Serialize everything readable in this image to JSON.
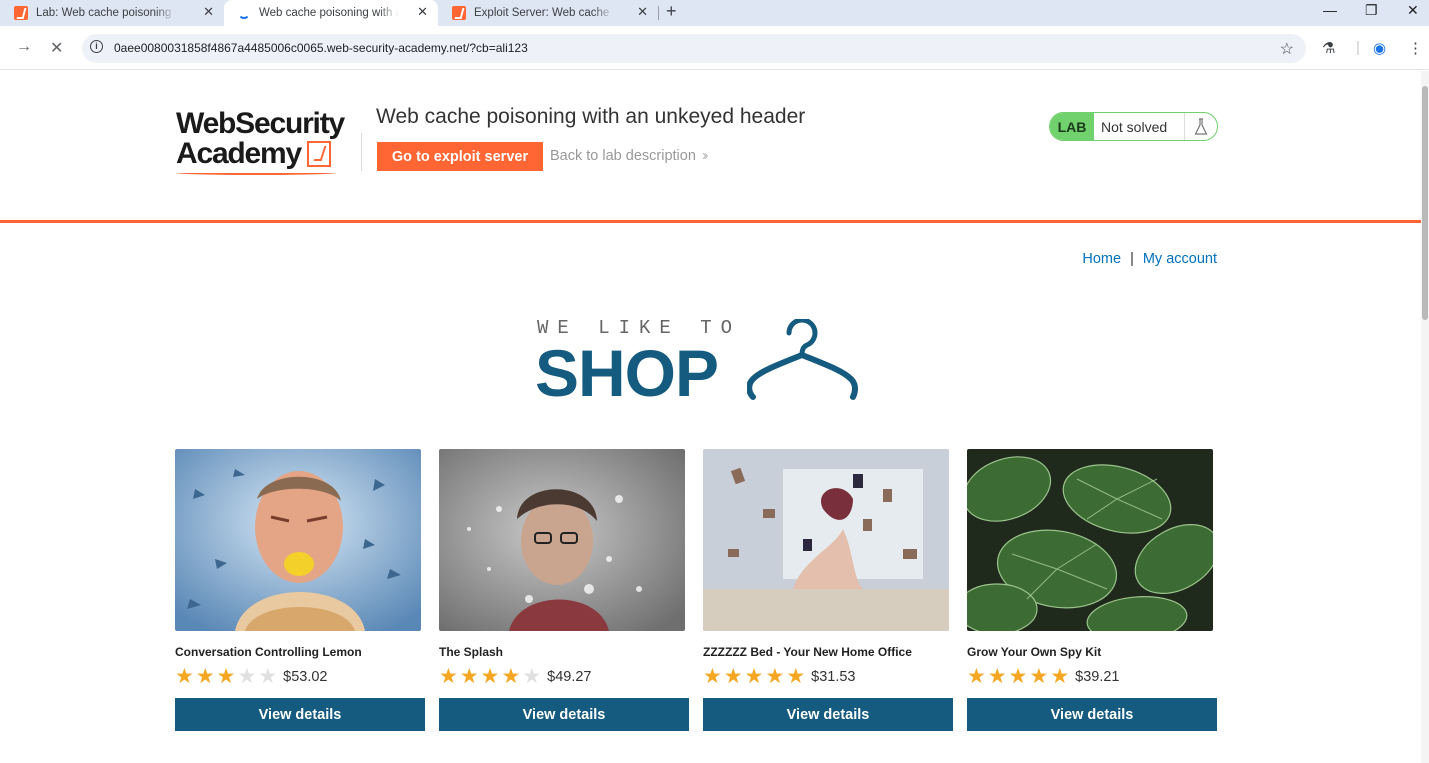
{
  "browser": {
    "tabs": [
      {
        "title": "Lab: Web cache poisoning with an unkeyed header",
        "active": false
      },
      {
        "title": "Web cache poisoning with an unkeyed header",
        "active": true
      },
      {
        "title": "Exploit Server: Web cache poisoning with an unkeyed header",
        "active": false
      }
    ],
    "url": "0aee0080031858f4867a4485006c0065.web-security-academy.net/?cb=ali123"
  },
  "header": {
    "logo_line1": "WebSecurity",
    "logo_line2": "Academy",
    "lab_title": "Web cache poisoning with an unkeyed header",
    "exploit_button": "Go to exploit server",
    "back_link": "Back to lab description",
    "badge_label": "LAB",
    "badge_status": "Not solved",
    "accent_color": "#ff6633",
    "badge_color": "#70d16d"
  },
  "nav": {
    "home": "Home",
    "separator": "|",
    "account": "My account"
  },
  "banner": {
    "small": "WE LIKE TO",
    "big": "SHOP"
  },
  "products": [
    {
      "name": "Conversation Controlling Lemon",
      "rating": 3,
      "price": "$53.02",
      "button": "View details",
      "image": "man-biting-lemon"
    },
    {
      "name": "The Splash",
      "rating": 4,
      "price": "$49.27",
      "button": "View details",
      "image": "woman-water-splash"
    },
    {
      "name": "ZZZZZZ Bed - Your New Home Office",
      "rating": 5,
      "price": "$31.53",
      "button": "View details",
      "image": "woman-flying-books"
    },
    {
      "name": "Grow Your Own Spy Kit",
      "rating": 5,
      "price": "$39.21",
      "button": "View details",
      "image": "green-leaves"
    }
  ]
}
